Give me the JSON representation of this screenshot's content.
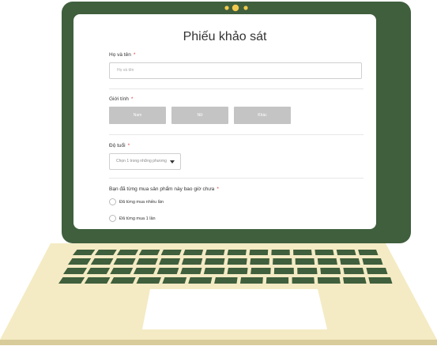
{
  "form": {
    "title": "Phiếu khảo sát",
    "name_label": "Họ và tên",
    "name_placeholder": "Họ và tên",
    "gender_label": "Giới tính",
    "gender_options": [
      "Nam",
      "Nữ",
      "Khác"
    ],
    "age_label": "Độ tuổi",
    "age_select_value": "Chọn 1 trong những phương",
    "purchase_question": "Bạn đã từng mua sản phẩm này bao giờ chưa",
    "purchase_options": [
      "Đã từng mua nhiều lần",
      "Đã từng mua 1 lần"
    ],
    "required_mark": "*"
  },
  "colors": {
    "laptop_frame": "#3f5f3d",
    "laptop_body": "#f4ebc4",
    "laptop_body_shadow": "#d8cc9a",
    "keys": "#3f5f3d",
    "touchpad": "#ffffff",
    "camera_dots": "#f2c94c",
    "button_gray": "#c4c4c4",
    "required": "#e23b3b"
  }
}
